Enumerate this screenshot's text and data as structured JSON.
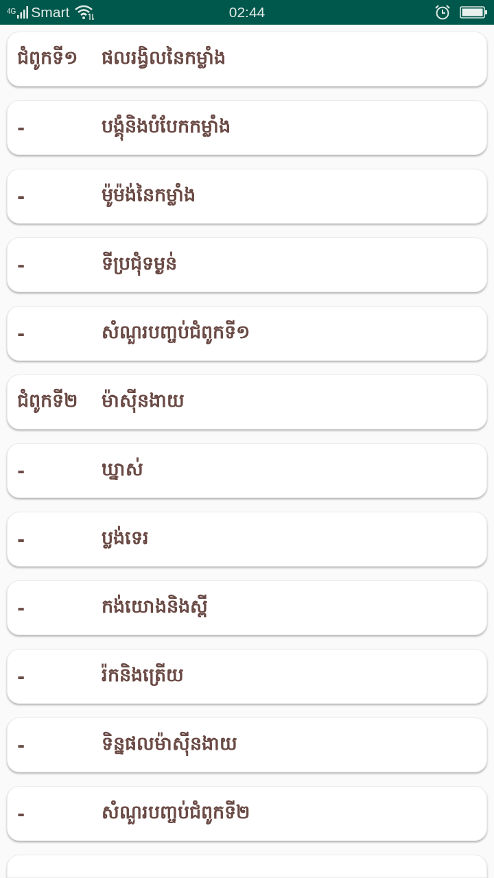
{
  "status_bar": {
    "network": "4G",
    "carrier": "Smart",
    "time": "02:44"
  },
  "items": [
    {
      "kind": "chapter",
      "label": "ជំពូកទី១",
      "title": "ផលរង្វិលនៃកម្លាំង"
    },
    {
      "kind": "lesson",
      "label": "-",
      "title": "បង្គុំនិងបំបែកកម្លាំង"
    },
    {
      "kind": "lesson",
      "label": "-",
      "title": "ម៉ូម៉ង់នៃកម្លាំង"
    },
    {
      "kind": "lesson",
      "label": "-",
      "title": "ទីប្រជុំទម្ងន់"
    },
    {
      "kind": "lesson",
      "label": "-",
      "title": "សំណួរបញ្ចប់ជំពូកទី១"
    },
    {
      "kind": "chapter",
      "label": "ជំពូកទី២",
      "title": "ម៉ាស៊ីនងាយ"
    },
    {
      "kind": "lesson",
      "label": "-",
      "title": "ឃ្នាស់"
    },
    {
      "kind": "lesson",
      "label": "-",
      "title": "ប្លង់ទេរ"
    },
    {
      "kind": "lesson",
      "label": "-",
      "title": "កង់យោងនិងស្ពី"
    },
    {
      "kind": "lesson",
      "label": "-",
      "title": "រ៉កនិងត្រើយ"
    },
    {
      "kind": "lesson",
      "label": "-",
      "title": "ទិន្នផលម៉ាស៊ីនងាយ"
    },
    {
      "kind": "lesson",
      "label": "-",
      "title": "សំណួរបញ្ចប់ជំពូកទី២"
    },
    {
      "kind": "partial"
    }
  ]
}
